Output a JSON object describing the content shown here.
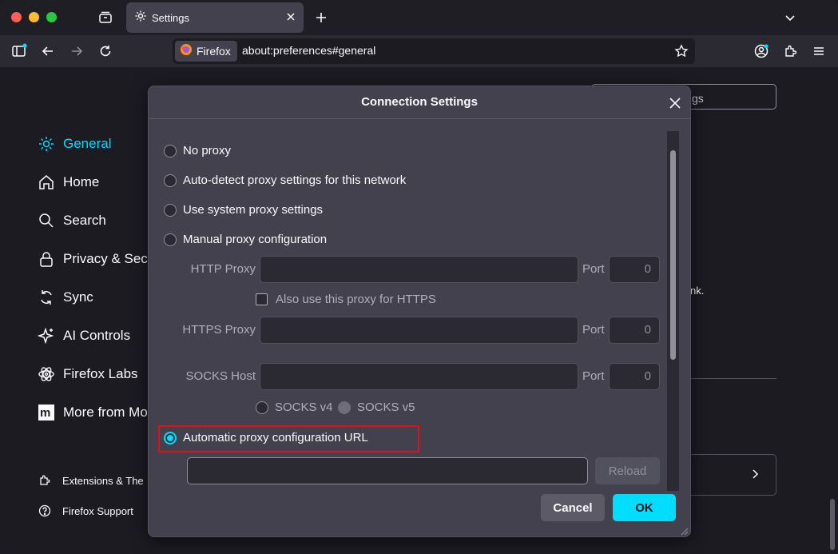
{
  "tab": {
    "title": "Settings"
  },
  "urlbar": {
    "identity_label": "Firefox",
    "url": "about:preferences#general"
  },
  "sidebar": {
    "items": [
      {
        "label": "General",
        "icon": "gear-icon",
        "active": true
      },
      {
        "label": "Home",
        "icon": "home-icon"
      },
      {
        "label": "Search",
        "icon": "search-icon"
      },
      {
        "label": "Privacy & Secu",
        "icon": "lock-icon"
      },
      {
        "label": "Sync",
        "icon": "sync-icon"
      },
      {
        "label": "AI Controls",
        "icon": "sparkle-icon"
      },
      {
        "label": "Firefox Labs",
        "icon": "atom-icon"
      },
      {
        "label": "More from Moz",
        "icon": "mozilla-m-icon"
      }
    ],
    "footer": [
      {
        "label": "Extensions & The",
        "icon": "puzzle-icon"
      },
      {
        "label": "Firefox Support",
        "icon": "help-icon"
      }
    ]
  },
  "background": {
    "find_placeholder_fragment": "gs",
    "text_fragment": "nk."
  },
  "dialog": {
    "title": "Connection Settings",
    "options": {
      "no_proxy": "No proxy",
      "auto_detect": "Auto-detect proxy settings for this network",
      "system": "Use system proxy settings",
      "manual": "Manual proxy configuration",
      "auto_url": "Automatic proxy configuration URL"
    },
    "selected_option": "auto_url",
    "manual": {
      "http_label": "HTTP Proxy",
      "http_port": "0",
      "also_https_label": "Also use this proxy for HTTPS",
      "https_label": "HTTPS Proxy",
      "https_port": "0",
      "socks_label": "SOCKS Host",
      "socks_port": "0",
      "port_label": "Port",
      "socks_v4": "SOCKS v4",
      "socks_v5": "SOCKS v5"
    },
    "auto_url_value": "",
    "reload_label": "Reload",
    "cancel_label": "Cancel",
    "ok_label": "OK"
  },
  "colors": {
    "accent": "#00ddff",
    "highlight": "#e0101a",
    "dialog_bg": "#42414d"
  }
}
